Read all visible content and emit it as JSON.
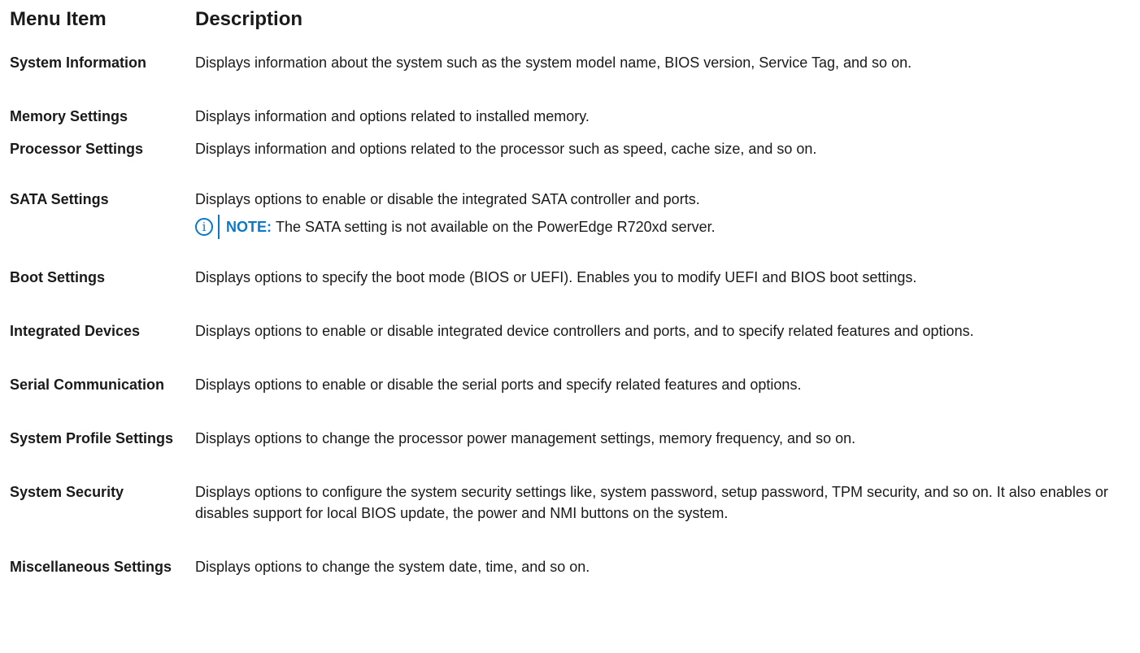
{
  "table": {
    "header": {
      "item": "Menu Item",
      "description": "Description"
    },
    "rows": [
      {
        "item": "System Information",
        "description": "Displays information about the system such as the system model name, BIOS version, Service Tag, and so on."
      },
      {
        "item": "Memory Settings",
        "description": "Displays information and options related to installed memory."
      },
      {
        "item": "Processor Settings",
        "description": "Displays information and options related to the processor such as speed, cache size, and so on."
      },
      {
        "item": "SATA Settings",
        "description": "Displays options to enable or disable the integrated SATA controller and ports.",
        "note": {
          "label": "NOTE:",
          "text": "The SATA setting is not available on the PowerEdge R720xd server.",
          "icon": "info-icon",
          "color": "#0b78c8"
        }
      },
      {
        "item": "Boot Settings",
        "description": "Displays options to specify the boot mode (BIOS or UEFI). Enables you to modify UEFI and BIOS boot settings."
      },
      {
        "item": "Integrated Devices",
        "description": "Displays options to enable or disable integrated device controllers and ports, and to specify related features and options."
      },
      {
        "item": "Serial Communication",
        "description": "Displays options to enable or disable the serial ports and specify related features and options."
      },
      {
        "item": "System Profile Settings",
        "description": "Displays options to change the processor power management settings, memory frequency, and so on."
      },
      {
        "item": "System Security",
        "description": "Displays options to configure the system security settings like, system password, setup password, TPM security, and so on. It also enables or disables support for local BIOS update, the power and NMI buttons on the system."
      },
      {
        "item": "Miscellaneous Settings",
        "description": "Displays options to change the system date, time, and so on."
      }
    ]
  }
}
